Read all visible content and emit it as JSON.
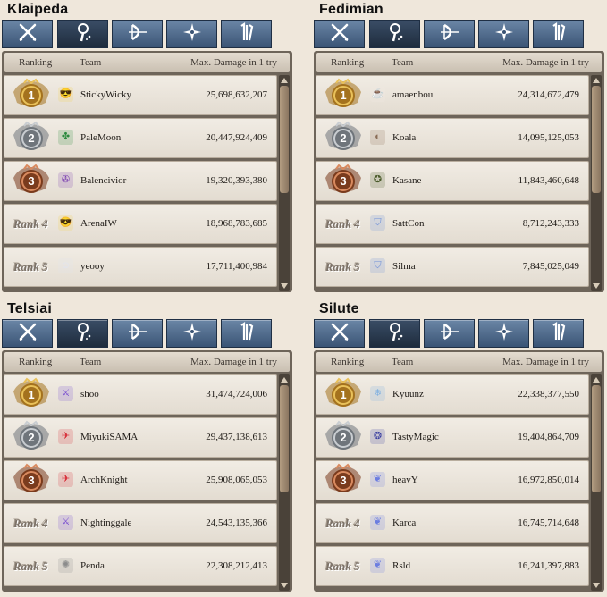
{
  "header": {
    "ranking": "Ranking",
    "team": "Team",
    "damage": "Max. Damage in 1 try"
  },
  "tab_icons": [
    "crossed-swords-icon",
    "wizard-staff-icon",
    "bow-icon",
    "shuriken-icon",
    "fist-icon"
  ],
  "colors": {
    "tab": "#4c6685",
    "tab_active": "#2a3a50",
    "gold": "#d9a83a",
    "silver": "#9ea3a8",
    "bronze": "#b0603a"
  },
  "panels": [
    {
      "server": "Klaipeda",
      "rows": [
        {
          "rank": "1",
          "team": "StickyWicky",
          "damage": "25,698,632,207",
          "icon": "sunglasses-emoji-icon"
        },
        {
          "rank": "2",
          "team": "PaleMoon",
          "damage": "20,447,924,409",
          "icon": "green-emblem-icon"
        },
        {
          "rank": "3",
          "team": "Balencivior",
          "damage": "19,320,393,380",
          "icon": "purple-rune-icon"
        },
        {
          "rank": "Rank 4",
          "team": "ArenaIW",
          "damage": "18,968,783,685",
          "icon": "sunglasses-emoji-icon"
        },
        {
          "rank": "Rank 5",
          "team": "yeooy",
          "damage": "17,711,400,984",
          "icon": "anime-avatar-icon"
        }
      ]
    },
    {
      "server": "Fedimian",
      "rows": [
        {
          "rank": "1",
          "team": "amaenbou",
          "damage": "24,314,672,479",
          "icon": "coffee-cup-icon"
        },
        {
          "rank": "2",
          "team": "Koala",
          "damage": "14,095,125,053",
          "icon": "portrait-icon"
        },
        {
          "rank": "3",
          "team": "Kasane",
          "damage": "11,843,460,648",
          "icon": "dark-seal-icon"
        },
        {
          "rank": "Rank 4",
          "team": "SattCon",
          "damage": "8,712,243,333",
          "icon": "shield-icon"
        },
        {
          "rank": "Rank 5",
          "team": "Silma",
          "damage": "7,845,025,049",
          "icon": "shield-icon"
        }
      ]
    },
    {
      "server": "Telsiai",
      "rows": [
        {
          "rank": "1",
          "team": "shoo",
          "damage": "31,474,724,006",
          "icon": "purple-figure-icon"
        },
        {
          "rank": "2",
          "team": "MiyukiSAMA",
          "damage": "29,437,138,613",
          "icon": "red-bird-icon"
        },
        {
          "rank": "3",
          "team": "ArchKnight",
          "damage": "25,908,065,053",
          "icon": "red-bird-icon"
        },
        {
          "rank": "Rank 4",
          "team": "Nightinggale",
          "damage": "24,543,135,366",
          "icon": "purple-figure-icon"
        },
        {
          "rank": "Rank 5",
          "team": "Penda",
          "damage": "22,308,212,413",
          "icon": "wreath-emblem-icon"
        }
      ]
    },
    {
      "server": "Silute",
      "rows": [
        {
          "rank": "1",
          "team": "Kyuunz",
          "damage": "22,338,377,550",
          "icon": "snowflake-icon"
        },
        {
          "rank": "2",
          "team": "TastyMagic",
          "damage": "19,404,864,709",
          "icon": "swirl-icon"
        },
        {
          "rank": "3",
          "team": "heavY",
          "damage": "16,972,850,014",
          "icon": "wings-icon"
        },
        {
          "rank": "Rank 4",
          "team": "Karca",
          "damage": "16,745,714,648",
          "icon": "wings-icon"
        },
        {
          "rank": "Rank 5",
          "team": "Rsld",
          "damage": "16,241,397,883",
          "icon": "wings-icon"
        }
      ]
    }
  ]
}
